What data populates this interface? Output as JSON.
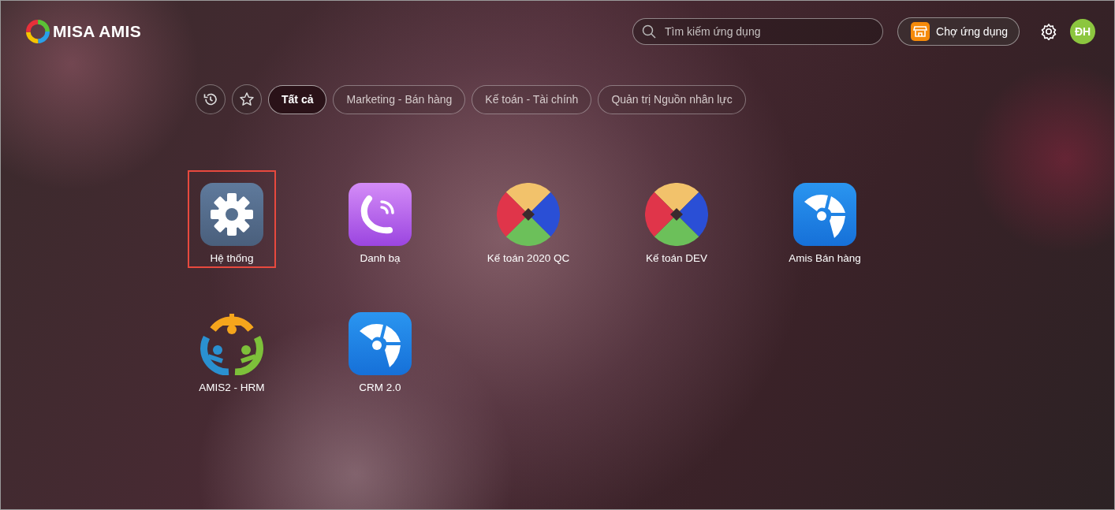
{
  "header": {
    "logo_text": "MISA AMIS",
    "search": {
      "placeholder": "Tìm kiếm ứng dụng"
    },
    "store_button": "Chợ ứng dụng",
    "avatar": "ĐH"
  },
  "filters": [
    {
      "label": "Tất cả",
      "selected": true
    },
    {
      "label": "Marketing - Bán hàng",
      "selected": false
    },
    {
      "label": "Kế toán - Tài chính",
      "selected": false
    },
    {
      "label": "Quản trị Nguồn nhân lực",
      "selected": false
    }
  ],
  "apps": [
    {
      "name": "Hệ thống",
      "kind": "gear",
      "highlighted": true
    },
    {
      "name": "Danh bạ",
      "kind": "phone",
      "highlighted": false
    },
    {
      "name": "Kế toán 2020 QC",
      "kind": "pinwheel",
      "highlighted": false
    },
    {
      "name": "Kế toán DEV",
      "kind": "pinwheel",
      "highlighted": false
    },
    {
      "name": "Amis Bán hàng",
      "kind": "pie",
      "highlighted": false
    },
    {
      "name": "AMIS2 - HRM",
      "kind": "people",
      "highlighted": false
    },
    {
      "name": "CRM 2.0",
      "kind": "pie",
      "highlighted": false
    }
  ]
}
